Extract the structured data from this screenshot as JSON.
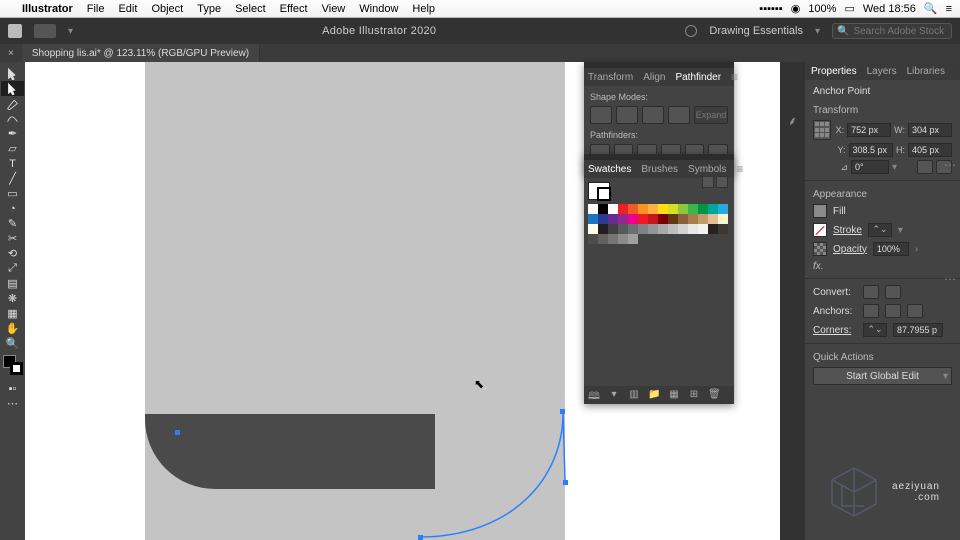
{
  "menubar": {
    "app": "Illustrator",
    "items": [
      "File",
      "Edit",
      "Object",
      "Type",
      "Select",
      "Effect",
      "View",
      "Window",
      "Help"
    ],
    "battery": "100%",
    "clock": "Wed 18:56"
  },
  "appbar": {
    "title": "Adobe Illustrator 2020",
    "workspace": "Drawing Essentials",
    "search_placeholder": "Search Adobe Stock"
  },
  "doc_tab": {
    "name": "Shopping lis.ai* @ 123.11% (RGB/GPU Preview)"
  },
  "pathfinder": {
    "tabs": [
      "Transform",
      "Align",
      "Pathfinder"
    ],
    "active": 2,
    "shape_modes_label": "Shape Modes:",
    "pathfinders_label": "Pathfinders:",
    "expand": "Expand"
  },
  "swatches": {
    "tabs": [
      "Swatches",
      "Brushes",
      "Symbols"
    ],
    "active": 0,
    "colors": [
      "#ffffff",
      "#000000",
      "#ffffff",
      "#ec2027",
      "#f05a28",
      "#f7931e",
      "#fbb040",
      "#ffde17",
      "#d7df23",
      "#8dc63f",
      "#39b54a",
      "#009444",
      "#00a79d",
      "#27aae1",
      "#1b75bc",
      "#2b3990",
      "#662d91",
      "#92278f",
      "#ec008c",
      "#ed1c24",
      "#c4161c",
      "#790000",
      "#603913",
      "#8b5e3c",
      "#a97c50",
      "#c49a6c",
      "#e0c092",
      "#fff2cc",
      "#fffde6",
      "#231f20",
      "#414042",
      "#58595b",
      "#6d6e71",
      "#808285",
      "#939598",
      "#a7a9ac",
      "#bcbec0",
      "#d1d3d4",
      "#e6e7e8",
      "#f1f2f2",
      "#27221f",
      "#3b3735",
      "#4f4c4a",
      "#636160",
      "#777675",
      "#8b8b8a",
      "#9fa09f"
    ]
  },
  "properties": {
    "tabs": [
      "Properties",
      "Layers",
      "Libraries"
    ],
    "active": 0,
    "selection": "Anchor Point",
    "transform_label": "Transform",
    "x": "752 px",
    "y": "308.5 px",
    "w": "304 px",
    "h": "405 px",
    "angle": "0°",
    "appearance_label": "Appearance",
    "fill": "Fill",
    "stroke": "Stroke",
    "opacity_label": "Opacity",
    "opacity": "100%",
    "fx": "fx.",
    "convert": "Convert:",
    "anchors": "Anchors:",
    "corners_label": "Corners:",
    "corners": "87.7955 p",
    "quick_actions": "Quick Actions",
    "global_edit": "Start Global Edit"
  },
  "watermark": {
    "line1": "aeziyuan",
    "line2": ".com"
  }
}
